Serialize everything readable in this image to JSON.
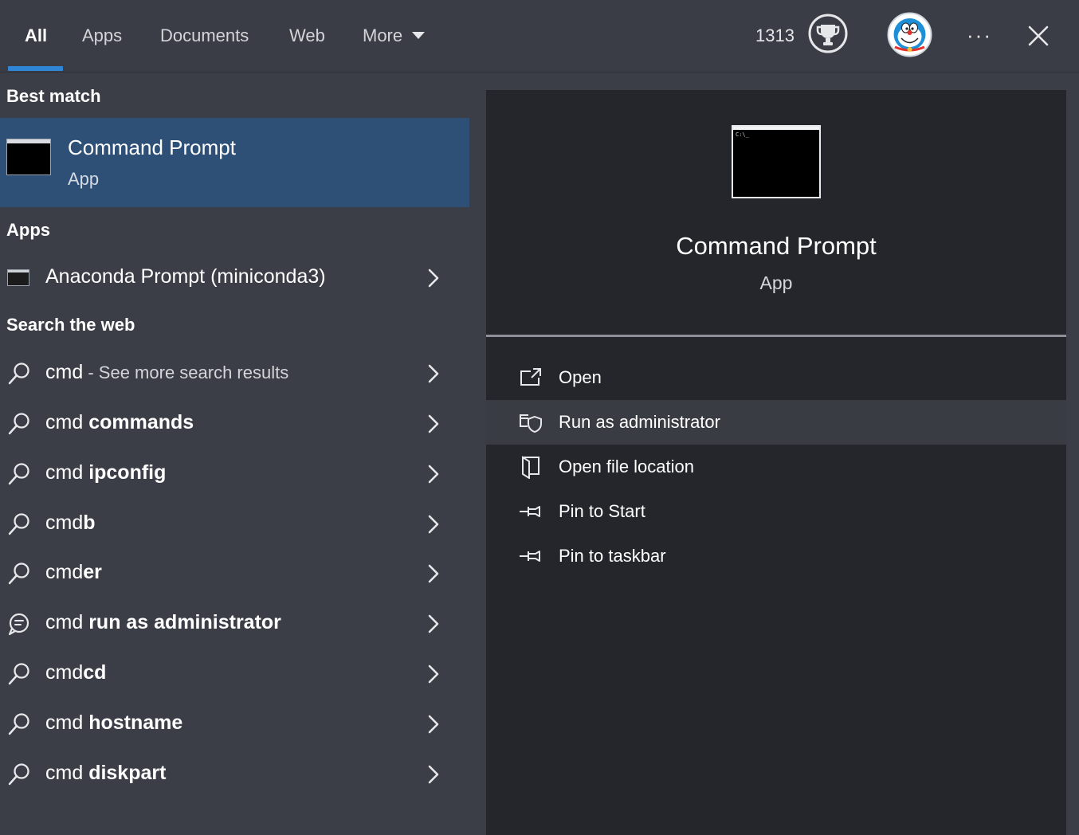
{
  "tabs": [
    {
      "label": "All",
      "active": true
    },
    {
      "label": "Apps"
    },
    {
      "label": "Documents"
    },
    {
      "label": "Web"
    },
    {
      "label": "More"
    }
  ],
  "header": {
    "points": "1313",
    "trophy_icon": "trophy-icon",
    "avatar_icon": "user-avatar",
    "more_options_label": "···",
    "close_icon": "close-icon"
  },
  "best_match": {
    "section_title": "Best match",
    "name": "Command Prompt",
    "type": "App",
    "icon": "command-prompt-icon"
  },
  "apps": {
    "section_title": "Apps",
    "items": [
      {
        "label": "Anaconda Prompt (miniconda3)",
        "icon": "terminal-icon"
      }
    ]
  },
  "web": {
    "section_title": "Search the web",
    "first": {
      "query": "cmd",
      "separator": " - ",
      "suffix": "See more search results"
    },
    "items": [
      {
        "prefix": "cmd ",
        "bold": "commands",
        "icon": "search-icon"
      },
      {
        "prefix": "cmd ",
        "bold": "ipconfig",
        "icon": "search-icon"
      },
      {
        "prefix": "cmd",
        "bold": "b",
        "icon": "search-icon"
      },
      {
        "prefix": "cmd",
        "bold": "er",
        "icon": "search-icon"
      },
      {
        "prefix": "cmd ",
        "bold": "run as administrator",
        "icon": "chat-icon"
      },
      {
        "prefix": "cmd",
        "bold": "cd",
        "icon": "search-icon"
      },
      {
        "prefix": "cmd ",
        "bold": "hostname",
        "icon": "search-icon"
      },
      {
        "prefix": "cmd ",
        "bold": "diskpart",
        "icon": "search-icon"
      }
    ]
  },
  "preview": {
    "name": "Command Prompt",
    "type": "App",
    "icon_prompt_text": "C:\\_",
    "actions": [
      {
        "label": "Open",
        "icon": "open-external-icon"
      },
      {
        "label": "Run as administrator",
        "icon": "shield-admin-icon",
        "highlighted": true
      },
      {
        "label": "Open file location",
        "icon": "file-location-icon"
      },
      {
        "label": "Pin to Start",
        "icon": "pin-icon"
      },
      {
        "label": "Pin to taskbar",
        "icon": "pin-icon"
      }
    ]
  },
  "colors": {
    "accent": "#2f86d6",
    "selected_bg": "#2e5077",
    "left_bg": "#3b3e47",
    "right_bg": "#25262b"
  }
}
